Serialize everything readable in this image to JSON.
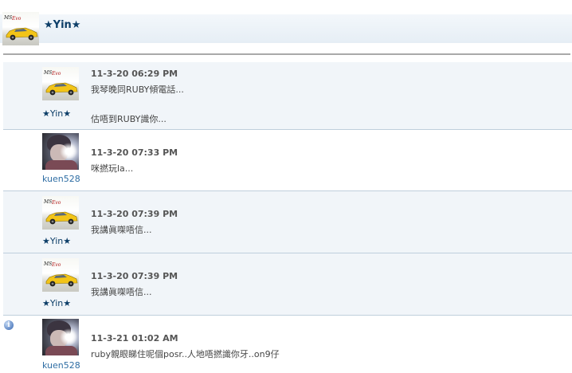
{
  "header": {
    "username": "★Yin★",
    "avatar_icon": "car-avatar-icon"
  },
  "posts": [
    {
      "username": "★Yin★",
      "avatar": "car",
      "date": "11-3-20 06:29 PM",
      "lines": [
        "我琴晚同RUBY傾電話...",
        "估唔到RUBY識你..."
      ]
    },
    {
      "username": "kuen528",
      "avatar": "person",
      "date": "11-3-20 07:33 PM",
      "lines": [
        "咪撚玩la..."
      ]
    },
    {
      "username": "★Yin★",
      "avatar": "car",
      "date": "11-3-20 07:39 PM",
      "lines": [
        "我講眞㗎唔信..."
      ]
    },
    {
      "username": "★Yin★",
      "avatar": "car",
      "date": "11-3-20 07:39 PM",
      "lines": [
        "我講眞㗎唔信..."
      ]
    },
    {
      "username": "kuen528",
      "avatar": "person",
      "date": "11-3-21 01:02 AM",
      "lines": [
        "ruby親眼睇住呢個posr..人地唔撚識你牙..on9仔"
      ]
    }
  ],
  "colors": {
    "accent": "#0d3e68",
    "link": "#2f6ea4",
    "row_alt": "#f1f5f9",
    "car_yellow": "#f2c418"
  }
}
